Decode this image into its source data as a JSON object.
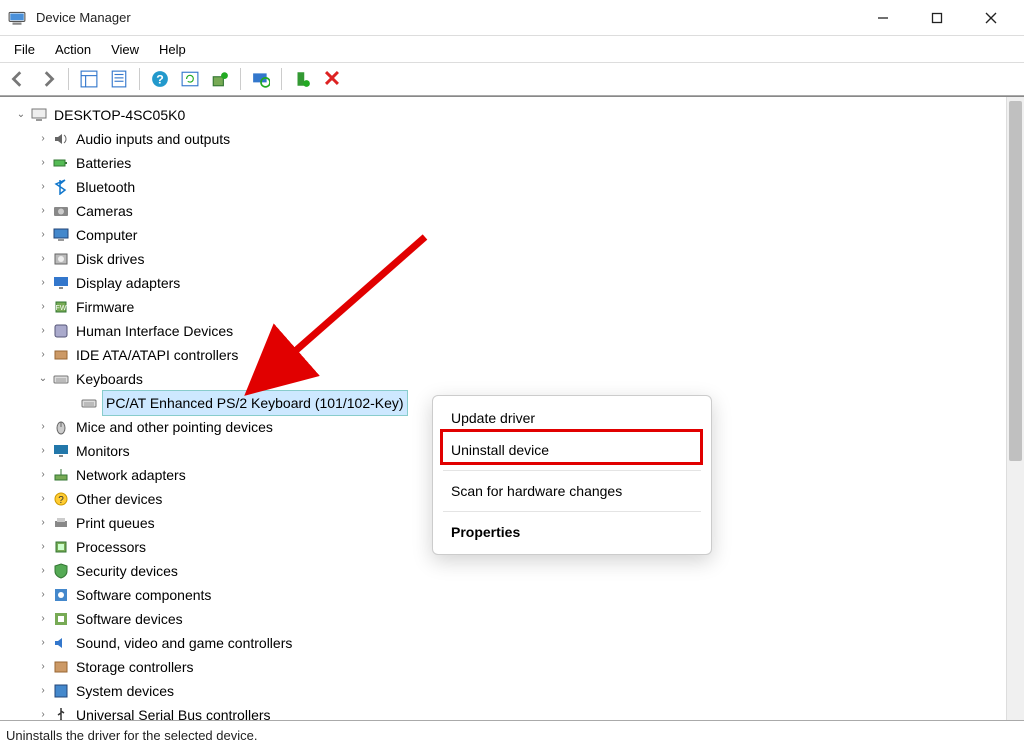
{
  "window": {
    "title": "Device Manager"
  },
  "menubar": {
    "items": [
      "File",
      "Action",
      "View",
      "Help"
    ]
  },
  "toolbar": {
    "btn_back": "back-icon",
    "btn_forward": "forward-icon",
    "btn_showhide": "showhide-icon",
    "btn_properties": "properties-icon",
    "btn_help": "help-icon",
    "btn_refresh": "refresh-icon",
    "btn_updatedriver": "updatedriver-icon",
    "btn_scanhw": "scanhw-icon",
    "btn_adddrivers": "adddrivers-icon",
    "btn_uninstall": "uninstall-icon"
  },
  "tree": {
    "root": {
      "label": "DESKTOP-4SC05K0",
      "expanded": true
    },
    "items": [
      {
        "label": "Audio inputs and outputs",
        "icon": "speaker-icon"
      },
      {
        "label": "Batteries",
        "icon": "battery-icon"
      },
      {
        "label": "Bluetooth",
        "icon": "bluetooth-icon"
      },
      {
        "label": "Cameras",
        "icon": "camera-icon"
      },
      {
        "label": "Computer",
        "icon": "computer-icon"
      },
      {
        "label": "Disk drives",
        "icon": "disk-icon"
      },
      {
        "label": "Display adapters",
        "icon": "display-icon"
      },
      {
        "label": "Firmware",
        "icon": "firmware-icon"
      },
      {
        "label": "Human Interface Devices",
        "icon": "hid-icon"
      },
      {
        "label": "IDE ATA/ATAPI controllers",
        "icon": "ide-icon"
      },
      {
        "label": "Keyboards",
        "icon": "keyboard-icon",
        "expanded": true,
        "children": [
          {
            "label": "PC/AT Enhanced PS/2 Keyboard (101/102-Key)",
            "icon": "keyboard-icon",
            "selected": true
          }
        ]
      },
      {
        "label": "Mice and other pointing devices",
        "icon": "mouse-icon"
      },
      {
        "label": "Monitors",
        "icon": "monitor-icon"
      },
      {
        "label": "Network adapters",
        "icon": "network-icon"
      },
      {
        "label": "Other devices",
        "icon": "other-icon"
      },
      {
        "label": "Print queues",
        "icon": "printer-icon"
      },
      {
        "label": "Processors",
        "icon": "cpu-icon"
      },
      {
        "label": "Security devices",
        "icon": "security-icon"
      },
      {
        "label": "Software components",
        "icon": "swcomp-icon"
      },
      {
        "label": "Software devices",
        "icon": "swdev-icon"
      },
      {
        "label": "Sound, video and game controllers",
        "icon": "sound-icon"
      },
      {
        "label": "Storage controllers",
        "icon": "storage-icon"
      },
      {
        "label": "System devices",
        "icon": "system-icon"
      },
      {
        "label": "Universal Serial Bus controllers",
        "icon": "usb-icon"
      }
    ]
  },
  "context_menu": {
    "items": [
      {
        "label": "Update driver"
      },
      {
        "label": "Uninstall device",
        "highlighted": true
      },
      {
        "separator": true
      },
      {
        "label": "Scan for hardware changes"
      },
      {
        "separator": true
      },
      {
        "label": "Properties",
        "bold": true
      }
    ]
  },
  "statusbar": {
    "text": "Uninstalls the driver for the selected device."
  },
  "annotation": {
    "arrow_color": "#e10000"
  }
}
